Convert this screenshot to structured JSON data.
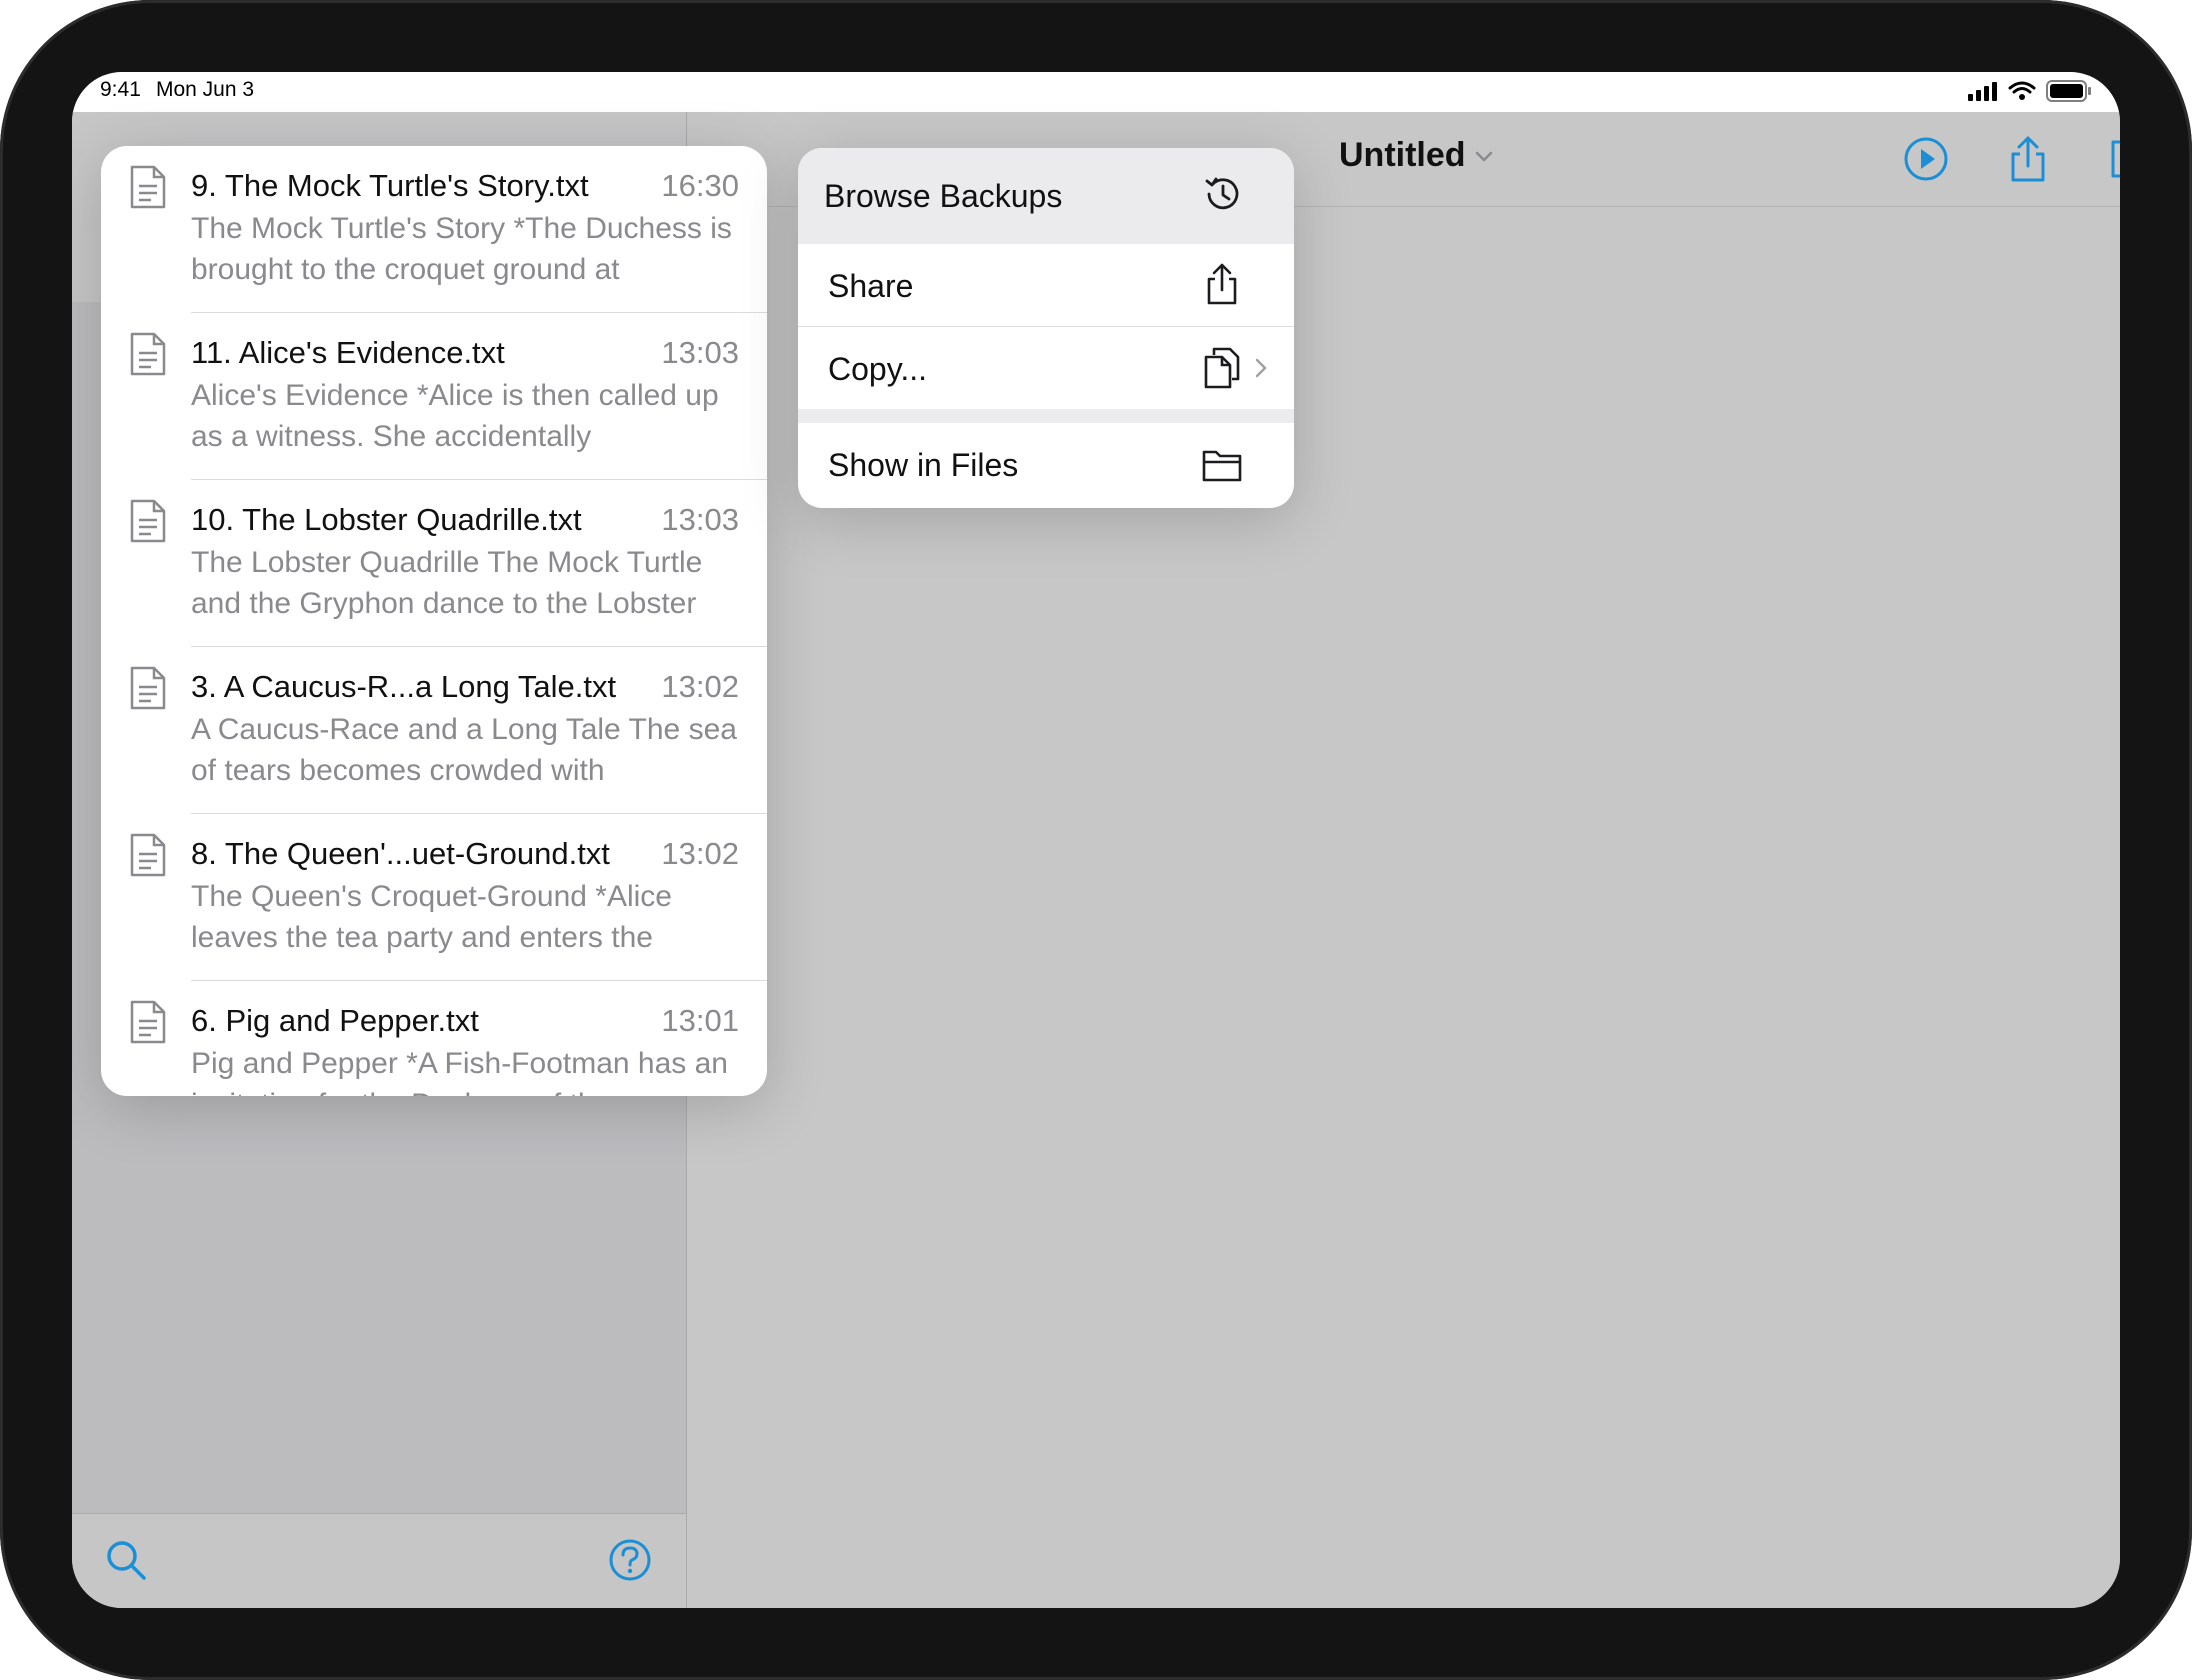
{
  "status_bar": {
    "time": "9:41",
    "date": "Mon Jun 3"
  },
  "document": {
    "title": "Untitled"
  },
  "files": [
    {
      "name": "9. The Mock Turtle's Story.txt",
      "time": "16:30",
      "preview": "The Mock Turtle's Story *The Duchess is brought to the croquet ground at"
    },
    {
      "name": "11. Alice's Evidence.txt",
      "time": "13:03",
      "preview": "Alice's Evidence *Alice is then called up as a witness. She accidentally"
    },
    {
      "name": "10. The Lobster Quadrille.txt",
      "time": "13:03",
      "preview": "The Lobster Quadrille The Mock Turtle and the Gryphon dance to the Lobster"
    },
    {
      "name": "3. A Caucus-R...a Long Tale.txt",
      "time": "13:02",
      "preview": "A Caucus-Race and a Long Tale The sea of tears becomes crowded with"
    },
    {
      "name": "8. The Queen'...uet-Ground.txt",
      "time": "13:02",
      "preview": "The Queen's Croquet-Ground *Alice leaves the tea party and enters the"
    },
    {
      "name": "6. Pig and Pepper.txt",
      "time": "13:01",
      "preview": "Pig and Pepper *A Fish-Footman has an invitation for the Duchess of the"
    }
  ],
  "menu": {
    "browse_backups": "Browse Backups",
    "share": "Share",
    "copy": "Copy...",
    "show_in_files": "Show in Files"
  },
  "colors": {
    "accent": "#1a8fd6",
    "dim_background": "#c7c7c7"
  }
}
